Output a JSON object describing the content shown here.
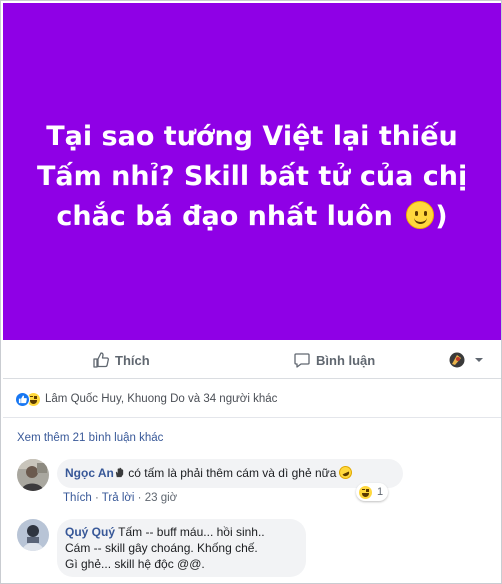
{
  "post": {
    "banner_lines": [
      "Tại sao tướng Việt lại thiếu",
      "Tấm nhỉ? Skill bất tử của chị",
      "chắc bá đạo nhất luôn"
    ],
    "banner_end": ")",
    "banner_color": "#8f00e6"
  },
  "actions": {
    "like_label": "Thích",
    "comment_label": "Bình luận"
  },
  "reactions": {
    "icons": [
      "like-icon",
      "haha-icon"
    ],
    "summary": "Lâm Quốc Huy, Khuong Do và 34 người khác"
  },
  "comments_section": {
    "view_more": "Xem thêm 21 bình luận khác",
    "comments": [
      {
        "author": "Ngọc An",
        "text": " có tấm là phải thêm cám và dì ghẻ nữa",
        "actions": {
          "like": "Thích",
          "reply": "Trả lời",
          "time": "23 giờ"
        },
        "reaction_count": "1"
      },
      {
        "author": "Quý Quý",
        "text_lines": [
          " Tấm -- buff máu... hồi sinh..",
          "Cám -- skill gây choáng. Khống chế.",
          "Gì ghẻ... skill hệ độc @@."
        ]
      }
    ]
  },
  "colors": {
    "link": "#385898",
    "like_blue": "#1877f2",
    "muted": "#606770",
    "bubble": "#f2f3f5"
  }
}
